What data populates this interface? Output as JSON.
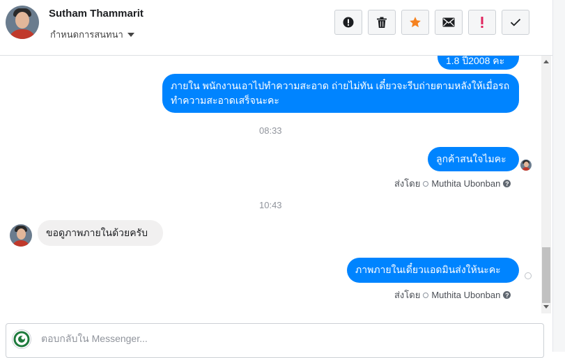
{
  "header": {
    "contact_name": "Sutham Thammarit",
    "label_dropdown": "กำหนดการสนทนา",
    "tools": [
      {
        "name": "report-spam",
        "icon": "alert-circle-icon"
      },
      {
        "name": "delete",
        "icon": "trash-icon"
      },
      {
        "name": "star",
        "icon": "star-icon",
        "color": "#f5821f"
      },
      {
        "name": "mark-unread",
        "icon": "envelope-icon"
      },
      {
        "name": "follow-up",
        "icon": "exclamation-icon",
        "color": "#e0245e"
      },
      {
        "name": "mark-done",
        "icon": "check-icon"
      }
    ]
  },
  "conversation": {
    "messages": [
      {
        "from": "page",
        "text_partial_top": "1.8 ปี2008 คะ"
      },
      {
        "from": "page",
        "text": "ภายใน พนักงานเอาไปทำความสะอาด ถ่ายไม่ทัน เดี๋ยวจะรีบถ่ายตามหลังให้เมื่อรถทำความสะอาดเสร็จนะคะ"
      },
      {
        "type": "timestamp",
        "text": "08:33"
      },
      {
        "from": "page",
        "text": "ลูกค้าสนใจไมคะ",
        "sent_by_prefix": "ส่งโดย",
        "sent_by": "Muthita Ubonban"
      },
      {
        "type": "timestamp",
        "text": "10:43"
      },
      {
        "from": "customer",
        "text": "ขอดูภาพภายในด้วยครับ"
      },
      {
        "from": "page",
        "text": "ภาพภายในเดี๋ยวแอดมินส่งให้นะคะ",
        "sent_by_prefix": "ส่งโดย",
        "sent_by": "Muthita Ubonban"
      }
    ]
  },
  "composer": {
    "placeholder": "ตอบกลับใน Messenger..."
  },
  "colors": {
    "outgoing_bubble": "#0084ff",
    "incoming_bubble": "#f1f0f0",
    "star": "#f5821f",
    "exclamation": "#e0245e"
  }
}
